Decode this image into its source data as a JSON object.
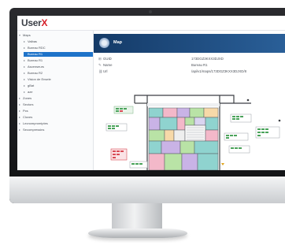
{
  "app": {
    "logo_main": "User",
    "logo_accent": "X"
  },
  "sidebar": {
    "items": [
      {
        "label": "Maps",
        "caret": "▾"
      },
      {
        "label": "Valbas",
        "caret": "▸"
      },
      {
        "label": "Bureau RDC",
        "caret": "▸"
      },
      {
        "label": "Bureau R1",
        "caret": "",
        "selected": true
      },
      {
        "label": "Bureau R1",
        "caret": "▸"
      },
      {
        "label": "Ascenseurs",
        "caret": "▸"
      },
      {
        "label": "Bureau R2",
        "caret": "▸"
      },
      {
        "label": "Vision de Ensele",
        "caret": "▸"
      },
      {
        "label": "gBat",
        "caret": "▸"
      },
      {
        "label": "aze",
        "caret": "▸"
      },
      {
        "label": "Zones",
        "caret": "▸"
      },
      {
        "label": "Sectors",
        "caret": "▸"
      },
      {
        "label": "Pcs",
        "caret": "▸"
      },
      {
        "label": "Cloves",
        "caret": "▸"
      },
      {
        "label": "Lecnompromiptes",
        "caret": "▸"
      },
      {
        "label": "Secompressins",
        "caret": "▸"
      }
    ]
  },
  "main": {
    "header_title": "Map",
    "properties": [
      {
        "icon": "id-icon",
        "glyph": "⊞",
        "label": "GUID",
        "value": "173DGZ3KXX3DJXD"
      },
      {
        "icon": "tag-icon",
        "glyph": "✎",
        "label": "Name",
        "value": "Bureau R1"
      },
      {
        "icon": "link-icon",
        "glyph": "⛓",
        "label": "Url",
        "value": "/api/v1/maps/173DGZ3KXX3DJXD/8"
      }
    ]
  },
  "colors": {
    "accent": "#d6202a",
    "selection": "#1e73c9",
    "header_dark": "#143a67",
    "room_teal": "#8fd3cf",
    "room_pink": "#f3b8c9",
    "room_green": "#b9e3a6",
    "room_violet": "#c9b3e6"
  }
}
